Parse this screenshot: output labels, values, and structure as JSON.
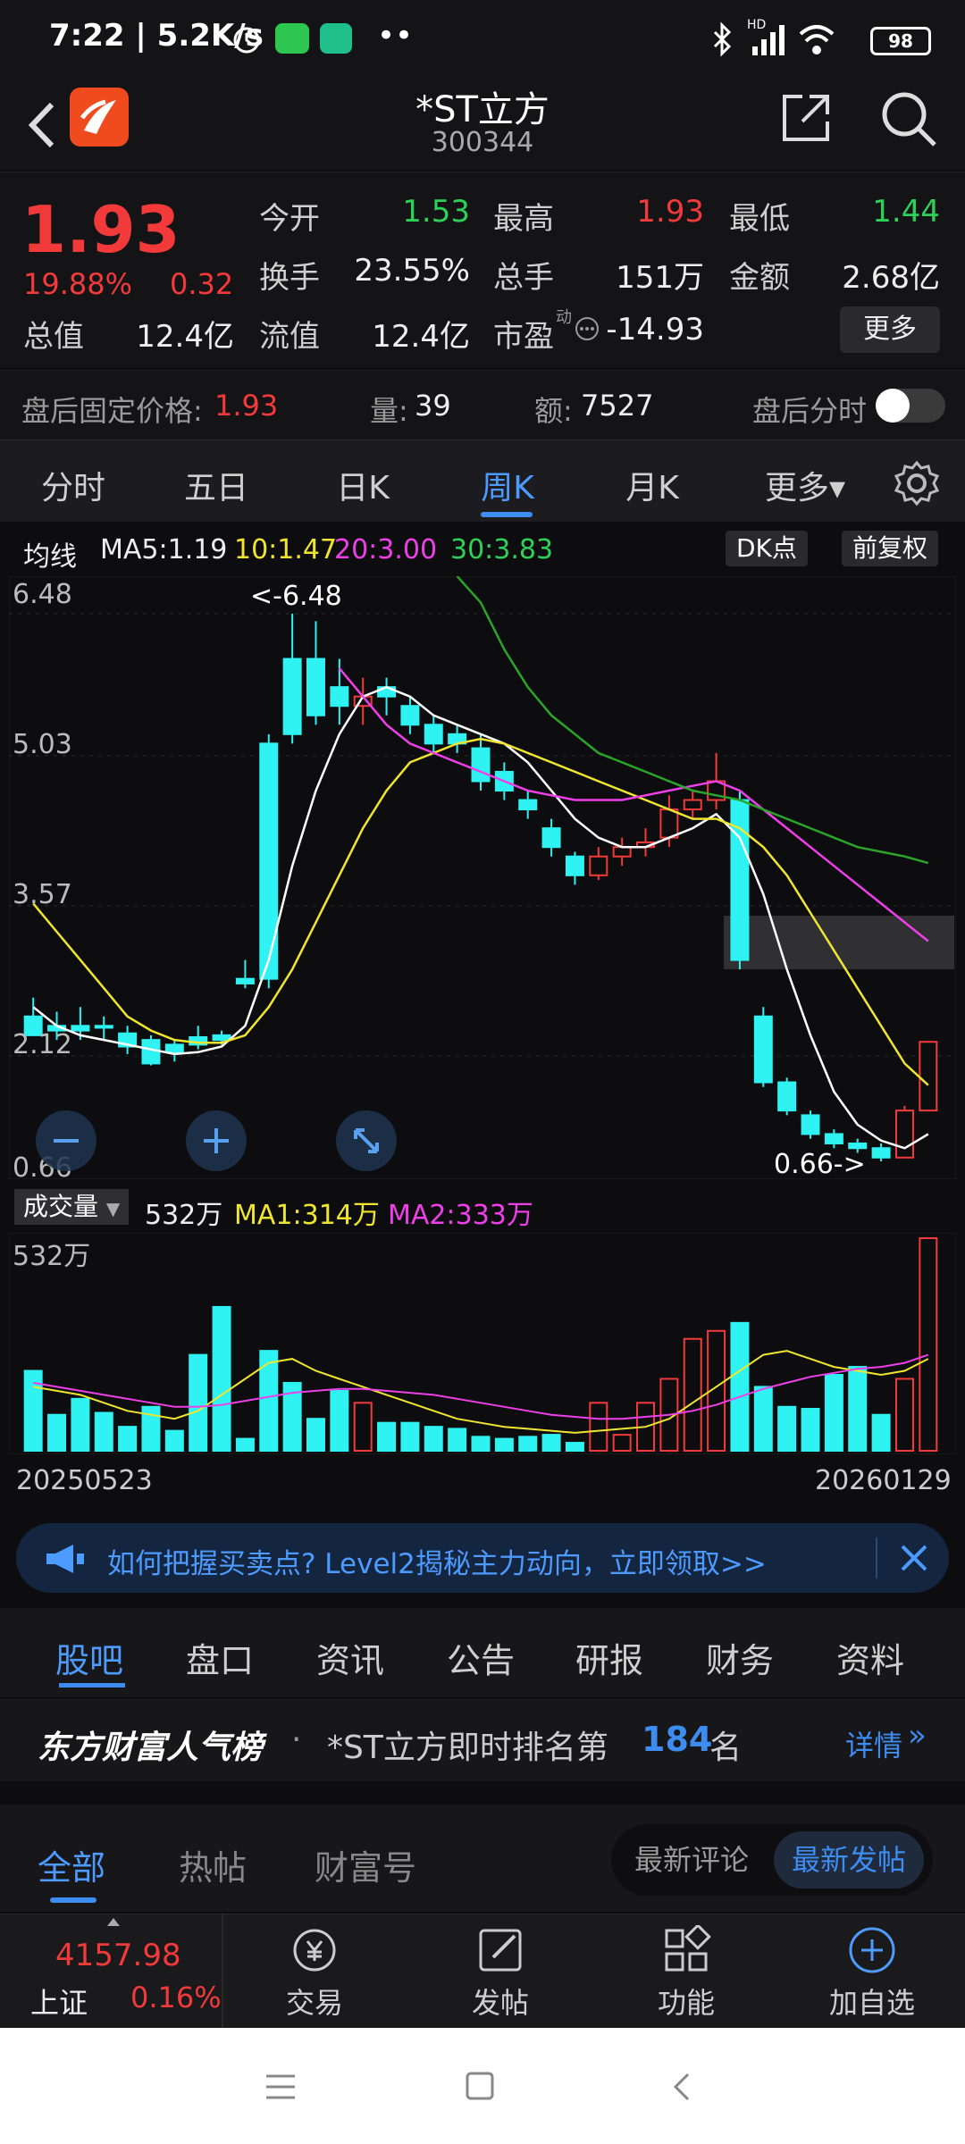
{
  "status_bar": {
    "time": "7:22 | 5.2K/s",
    "battery": "98",
    "dots": "••",
    "hd": "HD"
  },
  "header": {
    "title": "*ST立方",
    "code": "300344",
    "back_icon": "chevron-left-icon",
    "share_icon": "share-icon",
    "search_icon": "search-icon"
  },
  "quote": {
    "price": "1.93",
    "change_pct": "19.88%",
    "change": "0.32",
    "open_label": "今开",
    "open": "1.53",
    "high_label": "最高",
    "high": "1.93",
    "low_label": "最低",
    "low": "1.44",
    "turnover_label": "换手",
    "turnover": "23.55%",
    "volume_label": "总手",
    "volume": "151万",
    "amount_label": "金额",
    "amount": "2.68亿",
    "mktcap_label": "总值",
    "mktcap": "12.4亿",
    "float_label": "流值",
    "float": "12.4亿",
    "pe_label": "市盈",
    "pe_sup": "动",
    "pe": "-14.93",
    "more": "更多"
  },
  "after_hours": {
    "price_label": "盘后固定价格:",
    "price": "1.93",
    "vol_label": "量:",
    "vol": "39",
    "amt_label": "额:",
    "amt": "7527",
    "intraday_label": "盘后分时"
  },
  "period_tabs": [
    "分时",
    "五日",
    "日K",
    "周K",
    "月K",
    "更多▾"
  ],
  "ma_legend": {
    "label": "均线",
    "ma5": "MA5:1.19",
    "ma10": "10:1.47",
    "ma20": "20:3.00",
    "ma30": "30:3.83",
    "dk": "DK点",
    "adjust": "前复权"
  },
  "axis": {
    "y1": "6.48",
    "y2": "5.03",
    "y3": "3.57",
    "y4": "2.12",
    "y5": "0.66",
    "max_note": "<-6.48",
    "min_note": "0.66->"
  },
  "volume_legend": {
    "selector": "成交量",
    "vol": "532万",
    "ma1": "MA1:314万",
    "ma2": "MA2:333万",
    "axis_max": "532万"
  },
  "dates": {
    "start": "20250523",
    "end": "20260129"
  },
  "banner": {
    "text": "如何把握买卖点? Level2揭秘主力动向，立即领取>>",
    "icon": "megaphone-icon"
  },
  "section_tabs": [
    "股吧",
    "盘口",
    "资讯",
    "公告",
    "研报",
    "财务",
    "资料"
  ],
  "rank": {
    "brand": "东方财富人气榜",
    "dot": "·",
    "text": "*ST立方即时排名第",
    "num": "184",
    "unit": "名",
    "detail": "详情"
  },
  "filter_tabs": [
    "全部",
    "热帖",
    "财富号"
  ],
  "sort": {
    "latest_comment": "最新评论",
    "latest_post": "最新发帖"
  },
  "bottom_nav": {
    "index_value": "4157.98",
    "index_name": "上证",
    "index_pct": "0.16%",
    "items": [
      {
        "label": "交易",
        "icon": "yuan-trade-icon"
      },
      {
        "label": "发帖",
        "icon": "edit-icon"
      },
      {
        "label": "功能",
        "icon": "grid-icon"
      },
      {
        "label": "加自选",
        "icon": "plus-circle-icon"
      }
    ]
  },
  "chart_data": {
    "type": "candlestick",
    "ylim": [
      0.66,
      6.48
    ],
    "candles": [
      {
        "o": 2.2,
        "c": 2.0,
        "h": 2.4,
        "l": 2.0
      },
      {
        "o": 2.1,
        "c": 2.05,
        "h": 2.25,
        "l": 1.95
      },
      {
        "o": 2.1,
        "c": 2.05,
        "h": 2.3,
        "l": 1.95
      },
      {
        "o": 2.1,
        "c": 2.08,
        "h": 2.2,
        "l": 1.95
      },
      {
        "o": 2.02,
        "c": 1.88,
        "h": 2.1,
        "l": 1.8
      },
      {
        "o": 1.95,
        "c": 1.7,
        "h": 2.0,
        "l": 1.68
      },
      {
        "o": 1.9,
        "c": 1.82,
        "h": 1.95,
        "l": 1.72
      },
      {
        "o": 1.98,
        "c": 1.9,
        "h": 2.1,
        "l": 1.85
      },
      {
        "o": 2.0,
        "c": 1.95,
        "h": 2.05,
        "l": 1.9
      },
      {
        "o": 2.6,
        "c": 2.55,
        "h": 2.8,
        "l": 2.5
      },
      {
        "o": 5.1,
        "c": 2.6,
        "h": 5.2,
        "l": 2.5
      },
      {
        "o": 6.0,
        "c": 5.2,
        "h": 6.48,
        "l": 5.1
      },
      {
        "o": 6.0,
        "c": 5.4,
        "h": 6.4,
        "l": 5.3
      },
      {
        "o": 5.7,
        "c": 5.5,
        "h": 6.0,
        "l": 5.3
      },
      {
        "o": 5.5,
        "c": 5.6,
        "h": 5.8,
        "l": 5.3
      },
      {
        "o": 5.7,
        "c": 5.6,
        "h": 5.8,
        "l": 5.4
      },
      {
        "o": 5.5,
        "c": 5.3,
        "h": 5.6,
        "l": 5.2
      },
      {
        "o": 5.3,
        "c": 5.1,
        "h": 5.4,
        "l": 5.0
      },
      {
        "o": 5.2,
        "c": 5.1,
        "h": 5.3,
        "l": 5.0
      },
      {
        "o": 5.05,
        "c": 4.7,
        "h": 5.2,
        "l": 4.6
      },
      {
        "o": 4.8,
        "c": 4.6,
        "h": 4.9,
        "l": 4.5
      },
      {
        "o": 4.5,
        "c": 4.4,
        "h": 4.6,
        "l": 4.3
      },
      {
        "o": 4.2,
        "c": 4.0,
        "h": 4.3,
        "l": 3.9
      },
      {
        "o": 3.9,
        "c": 3.7,
        "h": 3.95,
        "l": 3.6
      },
      {
        "o": 3.7,
        "c": 3.9,
        "h": 4.0,
        "l": 3.65
      },
      {
        "o": 3.9,
        "c": 4.0,
        "h": 4.1,
        "l": 3.8
      },
      {
        "o": 4.0,
        "c": 4.05,
        "h": 4.2,
        "l": 3.9
      },
      {
        "o": 4.1,
        "c": 4.4,
        "h": 4.55,
        "l": 4.0
      },
      {
        "o": 4.4,
        "c": 4.5,
        "h": 4.6,
        "l": 4.3
      },
      {
        "o": 4.5,
        "c": 4.7,
        "h": 5.0,
        "l": 4.4
      },
      {
        "o": 4.5,
        "c": 2.8,
        "h": 4.6,
        "l": 2.7
      },
      {
        "o": 2.2,
        "c": 1.5,
        "h": 2.3,
        "l": 1.45
      },
      {
        "o": 1.5,
        "c": 1.2,
        "h": 1.55,
        "l": 1.15
      },
      {
        "o": 1.15,
        "c": 0.95,
        "h": 1.2,
        "l": 0.9
      },
      {
        "o": 0.95,
        "c": 0.85,
        "h": 1.0,
        "l": 0.8
      },
      {
        "o": 0.85,
        "c": 0.8,
        "h": 0.9,
        "l": 0.75
      },
      {
        "o": 0.8,
        "c": 0.7,
        "h": 0.85,
        "l": 0.66
      },
      {
        "o": 0.7,
        "c": 1.2,
        "h": 1.25,
        "l": 0.7
      },
      {
        "o": 1.2,
        "c": 1.93,
        "h": 1.93,
        "l": 1.2
      }
    ],
    "ma_series": {
      "ma5": [
        2.3,
        2.1,
        2.0,
        1.95,
        1.9,
        1.85,
        1.8,
        1.82,
        1.88,
        2.1,
        2.8,
        3.8,
        4.6,
        5.2,
        5.6,
        5.7,
        5.6,
        5.4,
        5.3,
        5.2,
        5.1,
        4.9,
        4.6,
        4.3,
        4.1,
        4.0,
        4.0,
        4.1,
        4.2,
        4.35,
        4.1,
        3.5,
        2.7,
        2.0,
        1.4,
        1.05,
        0.88,
        0.8,
        0.95
      ],
      "ma10": [
        3.4,
        3.1,
        2.8,
        2.5,
        2.2,
        2.05,
        1.95,
        1.92,
        1.92,
        2.0,
        2.3,
        2.7,
        3.2,
        3.7,
        4.2,
        4.6,
        4.9,
        5.0,
        5.1,
        5.15,
        5.1,
        5.0,
        4.9,
        4.8,
        4.7,
        4.6,
        4.5,
        4.4,
        4.3,
        4.3,
        4.2,
        4.0,
        3.7,
        3.3,
        2.9,
        2.5,
        2.1,
        1.7,
        1.47
      ],
      "ma20": [
        null,
        null,
        null,
        null,
        null,
        null,
        null,
        null,
        null,
        null,
        null,
        null,
        null,
        5.9,
        5.6,
        5.3,
        5.1,
        5.0,
        4.9,
        4.8,
        4.7,
        4.6,
        4.55,
        4.5,
        4.5,
        4.5,
        4.55,
        4.6,
        4.65,
        4.7,
        4.6,
        4.4,
        4.2,
        4.0,
        3.8,
        3.6,
        3.4,
        3.2,
        3.0
      ],
      "ma30": [
        null,
        null,
        null,
        null,
        null,
        null,
        null,
        null,
        null,
        null,
        null,
        null,
        null,
        null,
        null,
        null,
        null,
        null,
        7.2,
        6.6,
        6.1,
        5.7,
        5.4,
        5.2,
        5.0,
        4.9,
        4.8,
        4.7,
        4.6,
        4.55,
        4.5,
        4.4,
        4.3,
        4.2,
        4.1,
        4.0,
        3.95,
        3.9,
        3.83
      ]
    },
    "volume": [
      200,
      90,
      130,
      95,
      60,
      110,
      50,
      240,
      360,
      30,
      250,
      170,
      80,
      150,
      120,
      70,
      70,
      60,
      55,
      35,
      30,
      35,
      40,
      20,
      120,
      40,
      120,
      180,
      280,
      300,
      320,
      160,
      110,
      105,
      190,
      210,
      90,
      180,
      532
    ],
    "volume_ma1": [
      160,
      150,
      140,
      120,
      100,
      90,
      80,
      100,
      140,
      180,
      220,
      230,
      200,
      180,
      160,
      140,
      120,
      100,
      80,
      70,
      60,
      55,
      50,
      45,
      50,
      55,
      60,
      80,
      120,
      160,
      200,
      240,
      250,
      230,
      210,
      200,
      190,
      200,
      230
    ],
    "volume_ma2": [
      170,
      160,
      150,
      140,
      130,
      120,
      110,
      110,
      115,
      125,
      135,
      145,
      150,
      155,
      155,
      150,
      145,
      140,
      130,
      120,
      110,
      100,
      90,
      85,
      80,
      80,
      85,
      90,
      100,
      115,
      135,
      155,
      170,
      185,
      195,
      205,
      210,
      220,
      240
    ]
  }
}
